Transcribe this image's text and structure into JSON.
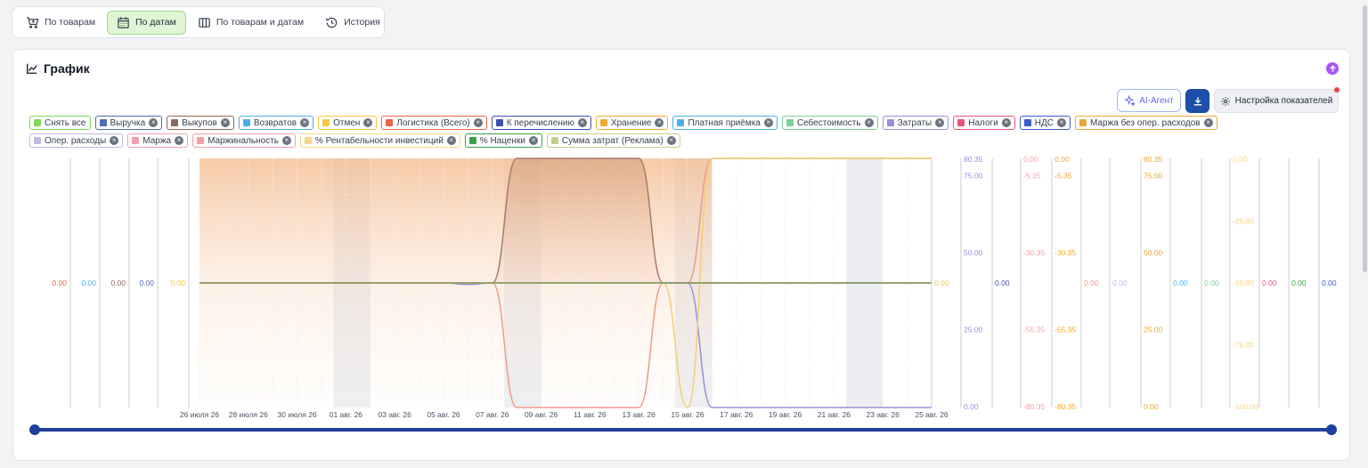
{
  "view_tabs": [
    {
      "label": "По товарам",
      "icon": "cart-icon",
      "active": false
    },
    {
      "label": "По датам",
      "icon": "calendar-icon",
      "active": true
    },
    {
      "label": "По товарам и датам",
      "icon": "columns-icon",
      "active": false
    },
    {
      "label": "История",
      "icon": "history-icon",
      "active": false
    }
  ],
  "card": {
    "title": "График",
    "ai_label": "AI-Агент",
    "settings_label": "Настройка показателей"
  },
  "chips": [
    {
      "label": "Снять все",
      "color": "#7ed957",
      "closable": false
    },
    {
      "label": "Выручка",
      "color": "#4f6bb5",
      "closable": true
    },
    {
      "label": "Выкупов",
      "color": "#8b6a5c",
      "closable": true
    },
    {
      "label": "Возвратов",
      "color": "#4eaee8",
      "closable": true
    },
    {
      "label": "Отмен",
      "color": "#f5c842",
      "closable": true
    },
    {
      "label": "Логистика (Всего)",
      "color": "#e8674a",
      "closable": true
    },
    {
      "label": "К перечислению",
      "color": "#3d4fb0",
      "closable": true
    },
    {
      "label": "Хранение",
      "color": "#f0a830",
      "closable": true
    },
    {
      "label": "Платная приёмка",
      "color": "#4ab0e8",
      "closable": true
    },
    {
      "label": "Себестоимость",
      "color": "#7fcf9a",
      "closable": true
    },
    {
      "label": "Затраты",
      "color": "#9b8ee0",
      "closable": true
    },
    {
      "label": "Налоги",
      "color": "#e8557a",
      "closable": true
    },
    {
      "label": "НДС",
      "color": "#3d5cc8",
      "closable": true
    },
    {
      "label": "Маржа без опер. расходов",
      "color": "#e8a93a",
      "closable": true
    },
    {
      "label": "Опер. расходы",
      "color": "#c4b8e0",
      "closable": true
    },
    {
      "label": "Маржа",
      "color": "#f0a0b0",
      "closable": true
    },
    {
      "label": "Маржинальность",
      "color": "#f4a0a8",
      "closable": true
    },
    {
      "label": "% Рентабельности инвестиций",
      "color": "#f5d78a",
      "closable": true
    },
    {
      "label": "% Наценки",
      "color": "#3aa04a",
      "closable": true
    },
    {
      "label": "Сумма затрат (Реклама)",
      "color": "#c8cc8a",
      "closable": true
    }
  ],
  "chart_data": {
    "type": "line",
    "x": [
      "26 июля 26",
      "27 июля 26",
      "28 июля 26",
      "29 июля 26",
      "30 июля 26",
      "31 июля 26",
      "01 авг. 26",
      "02 авг. 26",
      "03 авг. 26",
      "04 авг. 26",
      "05 авг. 26",
      "06 авг. 26",
      "07 авг. 26",
      "08 авг. 26",
      "09 авг. 26",
      "10 авг. 26",
      "11 авг. 26",
      "12 авг. 26",
      "13 авг. 26",
      "14 авг. 26",
      "15 авг. 26",
      "16 авг. 26",
      "17 авг. 26",
      "18 авг. 26",
      "19 авг. 26",
      "20 авг. 26",
      "21 авг. 26",
      "22 авг. 26",
      "23 авг. 26",
      "24 авг. 26",
      "25 авг. 26"
    ],
    "x_tick_labels": [
      "26 июля 26",
      "28 июля 26",
      "30 июля 26",
      "01 авг. 26",
      "03 авг. 26",
      "05 авг. 26",
      "07 авг. 26",
      "09 авг. 26",
      "11 авг. 26",
      "13 авг. 26",
      "15 авг. 26",
      "17 авг. 26",
      "19 авг. 26",
      "21 авг. 26",
      "23 авг. 26",
      "25 авг. 26"
    ],
    "weekend_bands": [
      [
        "01 авг. 26",
        "02 авг. 26"
      ],
      [
        "08 авг. 26",
        "09 авг. 26"
      ],
      [
        "15 авг. 26",
        "16 авг. 26"
      ],
      [
        "22 авг. 26",
        "23 авг. 26"
      ]
    ],
    "series": [
      {
        "color": "#a77a6c",
        "values": [
          0,
          0,
          0,
          0,
          0,
          0,
          0,
          0,
          0,
          0,
          0,
          0,
          0,
          80.35,
          80.35,
          80.35,
          80.35,
          80.35,
          80.35,
          0,
          0,
          0,
          0,
          0,
          0,
          0,
          0,
          0,
          0,
          0,
          0
        ]
      },
      {
        "color": "#f09a8a",
        "values": [
          0,
          0,
          0,
          0,
          0,
          0,
          0,
          0,
          0,
          0,
          0,
          0,
          0,
          -80.35,
          -80.35,
          -80.35,
          -80.35,
          -80.35,
          -80.35,
          0,
          0,
          80.35,
          80.35,
          80.35,
          80.35,
          80.35,
          80.35,
          80.35,
          80.35,
          80.35,
          80.35
        ]
      },
      {
        "color": "#9a8fd8",
        "values": [
          0,
          0,
          0,
          0,
          0,
          0,
          0,
          0,
          0,
          0,
          0,
          -1,
          0,
          0,
          0,
          0,
          0,
          0,
          0,
          0,
          0,
          -80.35,
          -80.35,
          -80.35,
          -80.35,
          -80.35,
          -80.35,
          -80.35,
          -80.35,
          -80.35,
          -80.35
        ]
      },
      {
        "color": "#f2cf74",
        "values": [
          0,
          0,
          0,
          0,
          0,
          0,
          0,
          0,
          0,
          0,
          0,
          0,
          0,
          0,
          0,
          0,
          0,
          0,
          0,
          0,
          -80.35,
          80.35,
          80.35,
          80.35,
          80.35,
          80.35,
          80.35,
          80.35,
          80.35,
          80.35,
          80.35
        ]
      },
      {
        "color": "#7f9a5a",
        "values": [
          0,
          0,
          0,
          0,
          0,
          0,
          0,
          0,
          0,
          0,
          0,
          0,
          0,
          0,
          0,
          0,
          0,
          0,
          0,
          0,
          0,
          0,
          0,
          0,
          0,
          0,
          0,
          0,
          0,
          0,
          0
        ]
      }
    ],
    "left_axes": [
      {
        "label": "0.00",
        "color": "#e8674a"
      },
      {
        "label": "0.00",
        "color": "#4eaee8"
      },
      {
        "label": "0.00",
        "color": "#8b6a5c"
      },
      {
        "label": "0.00",
        "color": "#4f6bb5"
      },
      {
        "label": "0.00",
        "color": "#f5c842"
      }
    ],
    "right_axes": [
      {
        "color": "#f5c842",
        "ticks": [
          "0.00"
        ]
      },
      {
        "color": "#9b8ee0",
        "ticks": [
          "80.35",
          "75.00",
          "50.00",
          "25.00",
          "0.00"
        ]
      },
      {
        "color": "#3d4fb0",
        "ticks": [
          "0.00"
        ]
      },
      {
        "color": "#f4a0a8",
        "ticks": [
          "0.00",
          "-5.35",
          "-30.35",
          "-55.35",
          "-80.35"
        ]
      },
      {
        "color": "#f0a830",
        "ticks": [
          "0.00",
          "-5.35",
          "-30.35",
          "-55.35",
          "-80.35"
        ]
      },
      {
        "color": "#f09a8a",
        "ticks": [
          "0.00"
        ]
      },
      {
        "color": "#c4b8e0",
        "ticks": [
          "0.00"
        ]
      },
      {
        "color": "#e8a93a",
        "ticks": [
          "80.35",
          "75.00",
          "50.00",
          "25.00",
          "0.00"
        ]
      },
      {
        "color": "#4ab0e8",
        "ticks": [
          "0.00"
        ]
      },
      {
        "color": "#7fcf9a",
        "ticks": [
          "0.00"
        ]
      },
      {
        "color": "#f5d78a",
        "ticks": [
          "0.00",
          "-25.00",
          "-50.00",
          "-75.00",
          "-100.00"
        ]
      },
      {
        "color": "#e8557a",
        "ticks": [
          "0.00"
        ]
      },
      {
        "color": "#3aa04a",
        "ticks": [
          "0.00"
        ]
      },
      {
        "color": "#3d5cc8",
        "ticks": [
          "0.00"
        ]
      }
    ],
    "ylim": [
      -80.35,
      80.35
    ],
    "grid": true
  }
}
